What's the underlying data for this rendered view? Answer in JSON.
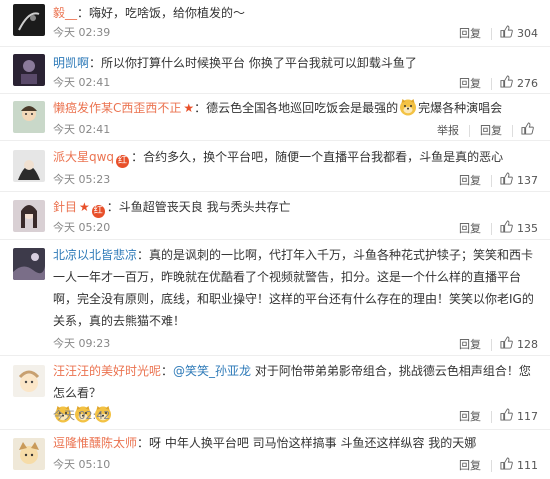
{
  "actions": {
    "reply": "回复",
    "report": "举报"
  },
  "comments": [
    {
      "name": "毅__",
      "text": "：嗨好，吃啥饭，给你植发的～",
      "time": "今天 02:39",
      "likes": "304"
    },
    {
      "name": "明凯啊",
      "text": "：所以你打算什么时候换平台 你换了平台我就可以卸载斗鱼了",
      "time": "今天 02:41",
      "likes": "276"
    },
    {
      "name": "懒癌发作某C西歪西不正",
      "text": "：德云色全国各地巡回吃饭会是最强的",
      "text2": "完爆各种演唱会",
      "time": "今天 02:41"
    },
    {
      "name": "派大星qwq",
      "text": "：合约多久，换个平台吧，随便一个直播平台我都看，斗鱼是真的恶心",
      "time": "今天 05:23",
      "likes": "137"
    },
    {
      "name": "針目",
      "text": "：斗鱼超管丧天良 我与秃头共存亡",
      "time": "今天 05:20",
      "likes": "135"
    },
    {
      "name": "北凉以北皆悲凉",
      "text": "：真的是讽刺的一比啊，代打年入千万，斗鱼各种花式护犊子；笑笑和西卡一人一年才一百万，昨晚就在优酷看了个视频就警告，扣分。这是一个什么样的直播平台啊，完全没有原则，底线，和职业操守！这样的平台还有什么存在的理由！笑笑以你老IG的关系，真的去熊猫不难！",
      "time": "今天 09:23",
      "likes": "128"
    },
    {
      "name": "汪汪汪的美好时光呢",
      "text": "：",
      "mention": "@笑笑_孙亚龙",
      "text2": " 对于阿怡带弟弟影帝组合，挑战德云色相声组合！您怎么看？",
      "time": "今天 02:42",
      "likes": "117"
    },
    {
      "name": "逗隆惟醺陈太师",
      "text": "：呀 中年人换平台吧 司马怡这样搞事 斗鱼还这样纵容 我的天娜",
      "time": "今天 05:10",
      "likes": "111"
    }
  ]
}
